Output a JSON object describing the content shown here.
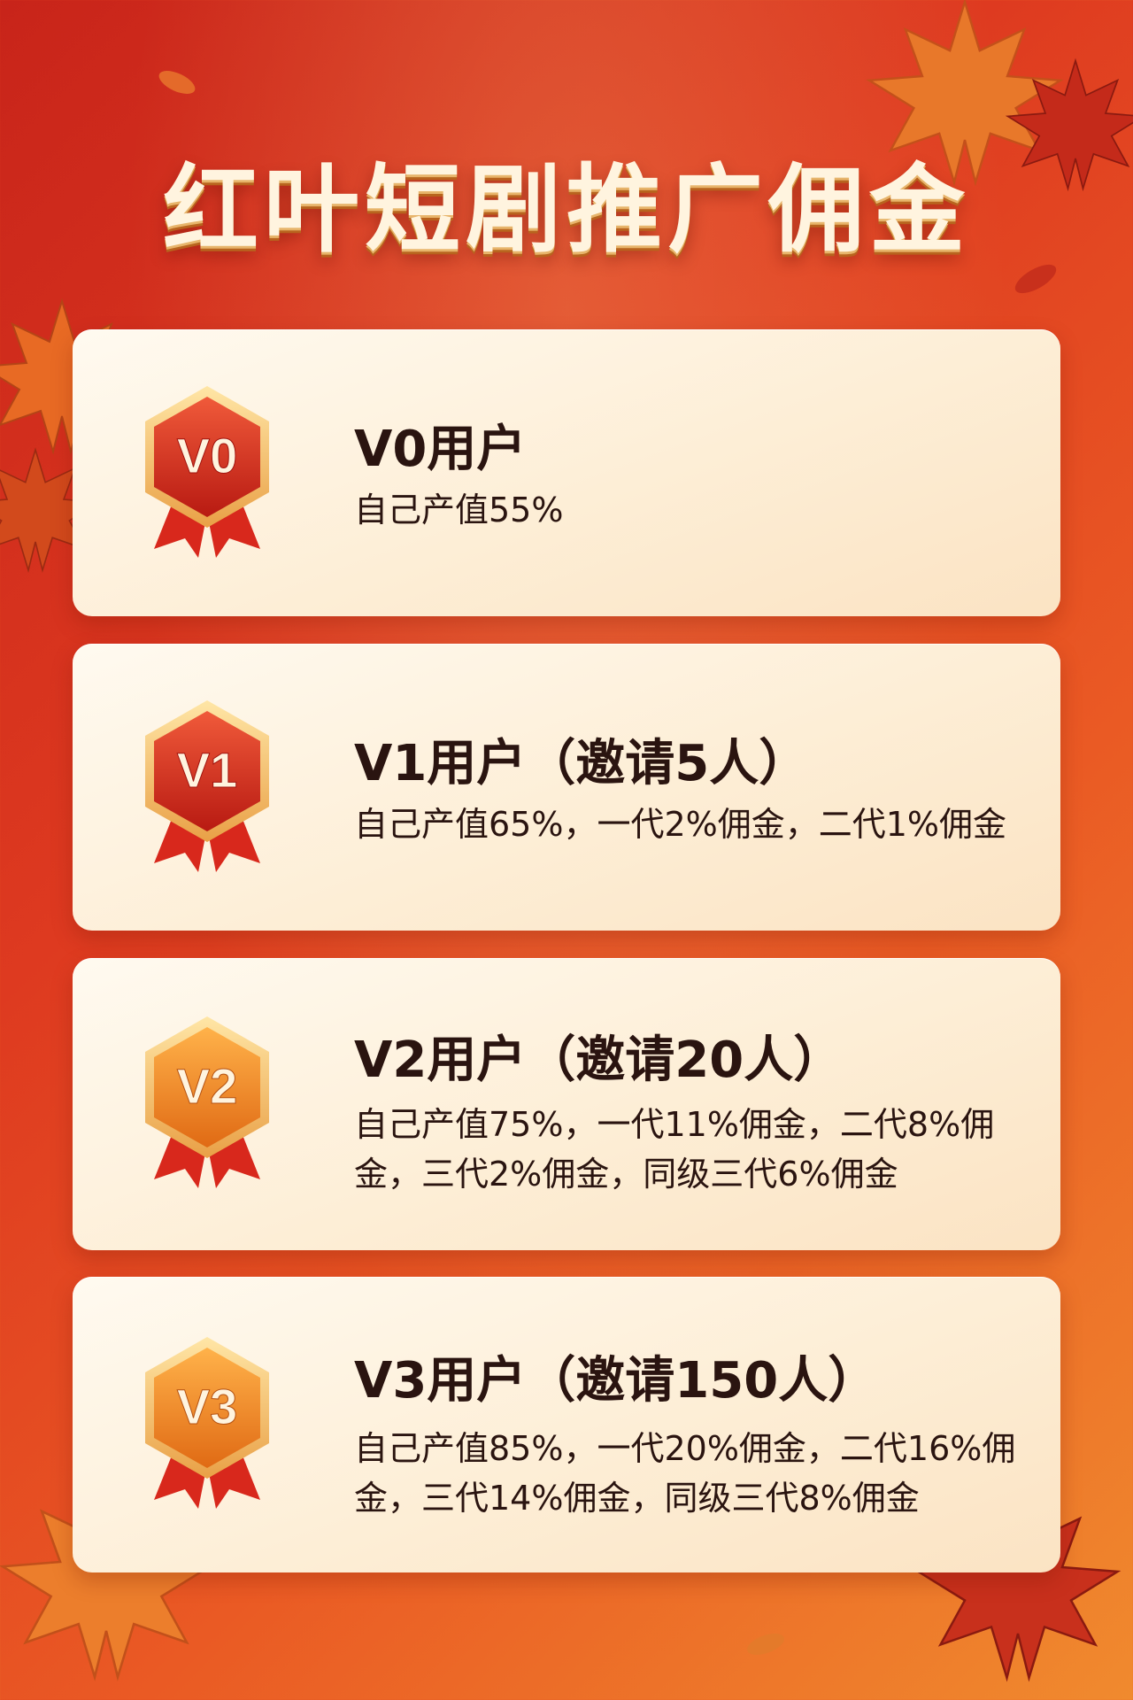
{
  "title": "红叶短剧推广佣金",
  "levels": [
    {
      "badge": "V0",
      "title": "V0用户",
      "description": "自己产值55%",
      "badge_color": "red"
    },
    {
      "badge": "V1",
      "title": "V1用户（邀请5人）",
      "description": "自己产值65%，一代2%佣金，二代1%佣金",
      "badge_color": "red"
    },
    {
      "badge": "V2",
      "title": "V2用户（邀请20人）",
      "description": "自己产值75%，一代11%佣金，二代8%佣金，三代2%佣金，同级三代6%佣金",
      "badge_color": "orange"
    },
    {
      "badge": "V3",
      "title": "V3用户（邀请150人）",
      "description": "自己产值85%，一代20%佣金，二代16%佣金，三代14%佣金，同级三代8%佣金",
      "badge_color": "orange"
    }
  ],
  "colors": {
    "background_start": "#c8241a",
    "background_end": "#f08a2e",
    "card": "#fdeed6",
    "text": "#2a1410",
    "badge_red": "#d42a1c",
    "badge_orange": "#f08a24",
    "ribbon": "#d8281c"
  }
}
